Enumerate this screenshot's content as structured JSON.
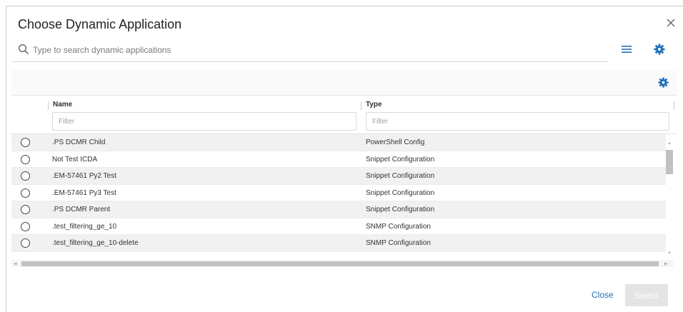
{
  "dialog": {
    "title": "Choose Dynamic Application",
    "close_icon": "close-icon"
  },
  "search": {
    "placeholder": "Type to search dynamic applications",
    "value": "",
    "icon": "search-icon"
  },
  "toolbar": {
    "menu_icon": "hamburger-menu-icon",
    "settings_icon": "gear-icon",
    "table_settings_icon": "gear-icon"
  },
  "colors": {
    "accent": "#1e6fb8",
    "row_alt": "#f1f1f1",
    "button_disabled": "#e4e4e4"
  },
  "table": {
    "columns": [
      {
        "label": "Name",
        "filter_placeholder": "Filter"
      },
      {
        "label": "Type",
        "filter_placeholder": "Filter"
      }
    ],
    "rows": [
      {
        "name": ".PS DCMR Child",
        "type": "PowerShell Config",
        "selected": false
      },
      {
        "name": "Not Test ICDA",
        "type": "Snippet Configuration",
        "selected": false
      },
      {
        "name": ".EM-57461 Py2 Test",
        "type": "Snippet Configuration",
        "selected": false
      },
      {
        "name": ".EM-57461 Py3 Test",
        "type": "Snippet Configuration",
        "selected": false
      },
      {
        "name": ".PS DCMR Parent",
        "type": "Snippet Configuration",
        "selected": false
      },
      {
        "name": ".test_filtering_ge_10",
        "type": "SNMP Configuration",
        "selected": false
      },
      {
        "name": ".test_filtering_ge_10-delete",
        "type": "SNMP Configuration",
        "selected": false
      }
    ]
  },
  "footer": {
    "close_label": "Close",
    "select_label": "Select",
    "select_enabled": false
  }
}
